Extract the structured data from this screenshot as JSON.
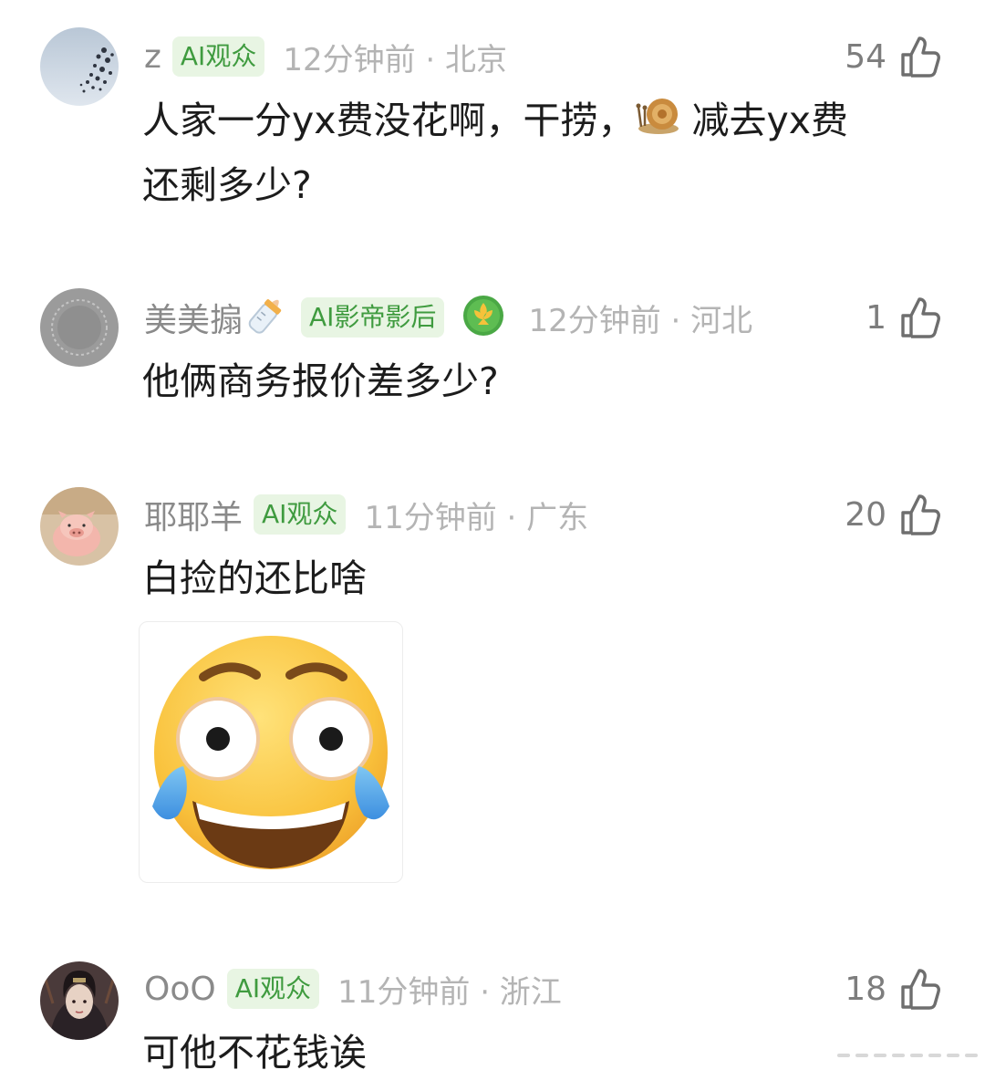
{
  "comments": [
    {
      "username": "z",
      "badge": "AI观众",
      "time_location": "12分钟前 · 北京",
      "likes": "54",
      "text_line1": "人家一分yx费没花啊，干捞，",
      "text_emoji": "snail-emoji",
      "text_line1_after": "减去yx费",
      "text_line2": "还剩多少?"
    },
    {
      "username": "美美搧",
      "username_emoji": "baby-bottle-emoji",
      "badge": "AI影帝影后",
      "badge_extra_icon": "green-flower-badge-icon",
      "time_location": "12分钟前 · 河北",
      "likes": "1",
      "text_line1": "他俩商务报价差多少?"
    },
    {
      "username": "耶耶羊",
      "badge": "AI观众",
      "time_location": "11分钟前 · 广东",
      "likes": "20",
      "text_line1": "白捡的还比啥",
      "sticker": "laughing-crying-emoji-sticker"
    },
    {
      "username": "OoO",
      "badge": "AI观众",
      "time_location": "11分钟前 · 浙江",
      "likes": "18",
      "text_line1": "可他不花钱诶"
    }
  ],
  "colors": {
    "badge_text": "#3f9b3f",
    "badge_bg": "#e8f5e3",
    "meta_gray": "#b4b4b4",
    "username_gray": "#8a8a8a"
  }
}
